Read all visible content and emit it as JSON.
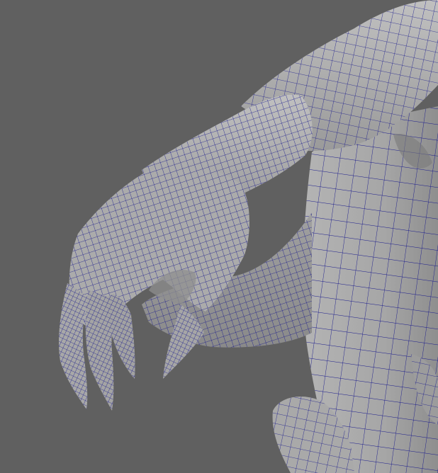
{
  "viewport": {
    "background_color": "#606060",
    "mesh_fill_color": "#aaaaaa",
    "wire_color": "#1a1a8c",
    "shade_color": "#8c8c8c",
    "highlight_color": "#c4c4c4",
    "shading_mode": "wireframe-on-shaded"
  },
  "model": {
    "parts": [
      "torso",
      "upper-arm",
      "forearm",
      "hand",
      "index-claw",
      "middle-claw",
      "ring-claw",
      "thumb-claw",
      "tail",
      "leg"
    ]
  }
}
